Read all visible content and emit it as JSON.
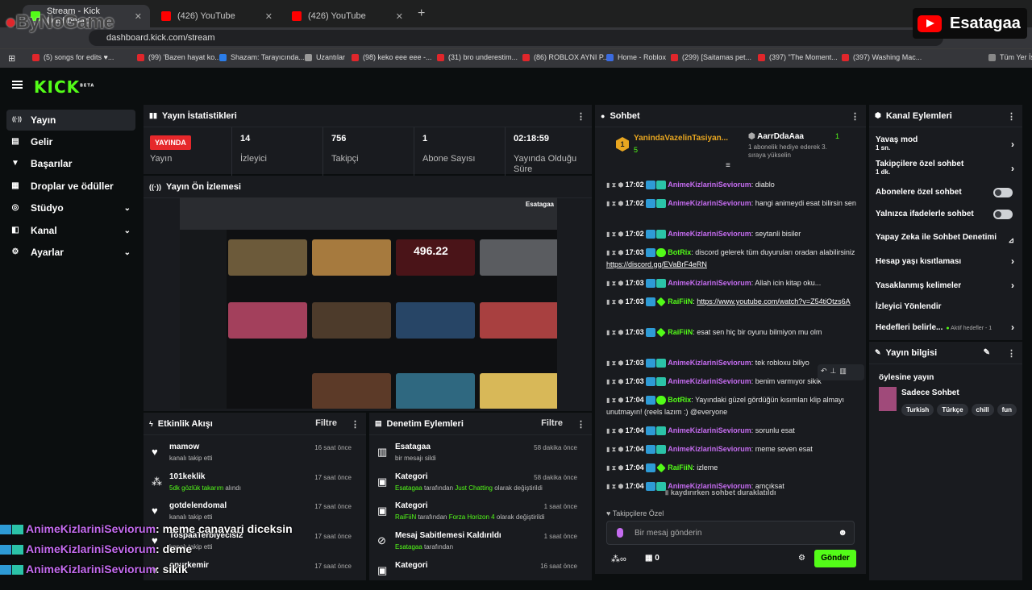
{
  "browser": {
    "tabs": [
      {
        "label": "Stream - Kick Dashboard",
        "color": "#53fc18"
      },
      {
        "label": "(426) YouTube",
        "color": "#ff0000"
      },
      {
        "label": "(426) YouTube",
        "color": "#ff0000"
      }
    ],
    "url": "dashboard.kick.com/stream",
    "bookmarks": [
      "(5) songs for edits ♥...",
      "(99) 'Bazen hayat ko...",
      "Shazam: Tarayıcında...",
      "Uzantılar",
      "(98) keko eee eee -...",
      "(31) bro underestim...",
      "(86) ROBLOX AYNI P...",
      "Home - Roblox",
      "(299) [Saitamas pet...",
      "(397) \"The Moment...",
      "(397) Washing Mac...",
      "Tüm Yer İş"
    ],
    "watermark_left": "ByNoGame",
    "watermark_right": "Esatagaa"
  },
  "kick": {
    "logo": "KICK",
    "beta": "BETA",
    "nav": [
      {
        "label": "Yayın",
        "icon": "broadcast-icon",
        "glyph": "((·))",
        "active": true
      },
      {
        "label": "Gelir",
        "icon": "income-icon",
        "glyph": "▤"
      },
      {
        "label": "Başarılar",
        "icon": "trophy-icon",
        "glyph": "🏆"
      },
      {
        "label": "Droplar ve ödüller",
        "icon": "gift-icon",
        "glyph": "🎁"
      },
      {
        "label": "Stüdyo",
        "icon": "studio-icon",
        "glyph": "◎",
        "chevron": true
      },
      {
        "label": "Kanal",
        "icon": "channel-icon",
        "glyph": "◧",
        "chevron": true
      },
      {
        "label": "Ayarlar",
        "icon": "settings-icon",
        "glyph": "⚙",
        "chevron": true
      }
    ]
  },
  "stats": {
    "title": "Yayın İstatistikleri",
    "live_badge": "YAYINDA",
    "live_label": "Yayın",
    "items": [
      {
        "value": "14",
        "label": "İzleyici"
      },
      {
        "value": "756",
        "label": "Takipçi"
      },
      {
        "value": "1",
        "label": "Abone Sayısı"
      },
      {
        "value": "02:18:59",
        "label": "Yayında Olduğu Süre"
      }
    ]
  },
  "preview": {
    "title": "Yayın Ön İzlemesi",
    "views": "496.22"
  },
  "activity": {
    "title": "Etkinlik Akışı",
    "filter": "Filtre",
    "items": [
      {
        "name": "mamow",
        "sub": "kanalı takip etti",
        "time": "16 saat önce",
        "icon": "heart-icon",
        "glyph": "♥"
      },
      {
        "name": "101keklik",
        "sub_green": "5dk gözlük takarım",
        "sub": " alındı",
        "time": "17 saat önce",
        "icon": "reward-icon",
        "glyph": "⁂"
      },
      {
        "name": "gotdelendomal",
        "sub": "kanalı takip etti",
        "time": "17 saat önce",
        "icon": "heart-icon",
        "glyph": "♥"
      },
      {
        "name": "TospaaTerbiyecisi2",
        "sub": "kanalı takip etti",
        "time": "17 saat önce",
        "icon": "heart-icon",
        "glyph": "♥"
      },
      {
        "name": "onurkemir",
        "sub": "",
        "time": "17 saat önce",
        "icon": "heart-icon",
        "glyph": "♥"
      }
    ]
  },
  "moderation": {
    "title": "Denetim Eylemleri",
    "filter": "Filtre",
    "items": [
      {
        "name": "Esatagaa",
        "sub": "bir mesajı sildi",
        "time": "58 dakika önce",
        "icon": "trash-icon",
        "glyph": "🗑"
      },
      {
        "name": "Kategori",
        "sub_user": "Esatagaa",
        "sub_mid": " tarafından ",
        "sub_green": "Just Chatting",
        "sub_end": " olarak değiştirildi",
        "time": "58 dakika önce",
        "icon": "category-icon",
        "glyph": "▣"
      },
      {
        "name": "Kategori",
        "sub_user": "RaiFiiN",
        "sub_mid": " tarafından ",
        "sub_green": "Forza Horizon 4",
        "sub_end": " olarak değiştirildi",
        "time": "1 saat önce",
        "icon": "category-icon",
        "glyph": "▣"
      },
      {
        "name": "Mesaj Sabitlemesi Kaldırıldı",
        "sub_user": "Esatagaa",
        "sub_mid": " tarafından",
        "sub_green": "",
        "sub_end": "",
        "time": "1 saat önce",
        "icon": "unpin-icon",
        "glyph": "⊘"
      },
      {
        "name": "Kategori",
        "sub": "",
        "time": "16 saat önce",
        "icon": "category-icon",
        "glyph": "▣"
      }
    ]
  },
  "chat": {
    "title": "Sohbet",
    "top_gifter": {
      "name": "YanindaVazelinTasiyan...",
      "count": "5",
      "rank": "1"
    },
    "second": {
      "name": "AarrDdaAaa",
      "sub": "1 abonelik hediye ederek 3. sıraya yükselin",
      "count": "1"
    },
    "messages": [
      {
        "time": "17:02",
        "user": "AnimeKizlariniSeviorum",
        "text": "diablo"
      },
      {
        "time": "17:02",
        "user": "AnimeKizlariniSeviorum",
        "text": "hangi animeydi esat bilirsin sen"
      },
      {
        "time": "17:02",
        "user": "AnimeKizlariniSeviorum",
        "text": "seytanli bisiler"
      },
      {
        "time": "17:03",
        "user": "BotRix",
        "bot": true,
        "text": "discord gelerek tüm duyuruları oradan alabilirsiniz ",
        "link": "https://discord.gg/EVaBrF4eRN"
      },
      {
        "time": "17:03",
        "user": "AnimeKizlariniSeviorum",
        "text": "Allah icin kitap oku..."
      },
      {
        "time": "17:03",
        "user": "RaiFiiN",
        "mod": true,
        "text": "",
        "link": "https://www.youtube.com/watch?v=Z54tiOtzs6A"
      },
      {
        "time": "17:03",
        "user": "RaiFiiN",
        "mod": true,
        "text": "esat sen hiç bir oyunu bilmiyon mu olm"
      },
      {
        "time": "17:03",
        "user": "AnimeKizlariniSeviorum",
        "text": "tek robloxu biliyo"
      },
      {
        "time": "17:03",
        "user": "AnimeKizlariniSeviorum",
        "text": "benim varmıyor sikik"
      },
      {
        "time": "17:04",
        "user": "BotRix",
        "bot": true,
        "text": "Yayındaki güzel gördüğün kısımları klip almayı unutmayın! (reels lazım :) @everyone"
      },
      {
        "time": "17:04",
        "user": "AnimeKizlariniSeviorum",
        "text": "sorunlu esat"
      },
      {
        "time": "17:04",
        "user": "AnimeKizlariniSeviorum",
        "text": "meme seven esat"
      },
      {
        "time": "17:04",
        "user": "RaiFiiN",
        "mod": true,
        "text": "izleme"
      },
      {
        "time": "17:04",
        "user": "AnimeKizlariniSeviorum",
        "text": "amçıksat"
      }
    ],
    "paused": "kaydırırken sohbet duraklatıldı",
    "followers_only": "Takipçilere Özel",
    "placeholder": "Bir mesaj gönderin",
    "points": "0",
    "send": "Gönder"
  },
  "channel_actions": {
    "title": "Kanal Eylemleri",
    "items": [
      {
        "label": "Yavaş mod",
        "sub": "1 sn.",
        "type": "chevron"
      },
      {
        "label": "Takipçilere özel sohbet",
        "sub": "1 dk.",
        "type": "chevron"
      },
      {
        "label": "Abonelere özel sohbet",
        "type": "toggle"
      },
      {
        "label": "Yalnızca ifadelerle sohbet",
        "type": "toggle"
      },
      {
        "label": "Yapay Zeka ile Sohbet Denetimi",
        "type": "chart"
      },
      {
        "label": "Hesap yaşı kısıtlaması",
        "type": "chevron"
      },
      {
        "label": "Yasaklanmış kelimeler",
        "type": "chevron"
      },
      {
        "label": "İzleyici Yönlendir",
        "type": "none"
      },
      {
        "label": "Hedefleri belirle...",
        "extra": "Aktif hedefler - 1",
        "type": "chevron"
      }
    ]
  },
  "stream_info": {
    "title": "Yayın bilgisi",
    "stream_title": "öylesine yayın",
    "category": "Sadece Sohbet",
    "tags": [
      "Turkish",
      "Türkçe",
      "chill",
      "fun"
    ]
  },
  "overlay_chat": [
    {
      "user": "AnimeKizlariniSeviorum",
      "text": ": meme canavari diceksin"
    },
    {
      "user": "AnimeKizlariniSeviorum",
      "text": ": deme"
    },
    {
      "user": "AnimeKizlariniSeviorum",
      "text": ": sikik"
    }
  ]
}
